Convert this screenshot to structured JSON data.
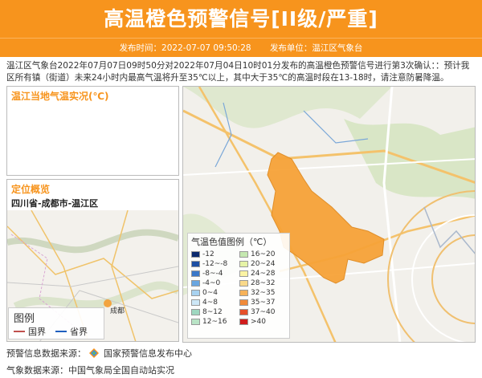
{
  "header": {
    "title": "高温橙色预警信号[II级/严重]",
    "publish_time_label": "发布时间：2022-07-07 09:50:28",
    "publisher_label": "发布单位：温江区气象台",
    "accent_color": "#f7941d"
  },
  "description": "温江区气象台2022年07月07日09时50分对2022年07月04日10时01分发布的高温橙色预警信号进行第3次确认：：预计我区所有镇（街道）未来24小时内最高气温将升至35℃以上，其中大于35℃的高温时段在13-18时，请注意防暑降温。",
  "temp_panel": {
    "title": "温江当地气温实况(℃)"
  },
  "location_panel": {
    "title": "定位概览",
    "subtitle": "四川省-成都市-温江区",
    "city_label": "成都"
  },
  "map_legend": {
    "title": "图例",
    "items": [
      {
        "label": "国界",
        "color": "#c0504d"
      },
      {
        "label": "省界",
        "color": "#1f5fbf"
      }
    ]
  },
  "temp_legend": {
    "title": "气温色值图例（℃）",
    "items": [
      {
        "label": "-12",
        "color": "#0b2a6f"
      },
      {
        "label": "16~20",
        "color": "#c5e8b0"
      },
      {
        "label": "-12~-8",
        "color": "#1d4fa3"
      },
      {
        "label": "20~24",
        "color": "#e6f3a6"
      },
      {
        "label": "-8~-4",
        "color": "#3a78c8"
      },
      {
        "label": "24~28",
        "color": "#fbf3a3"
      },
      {
        "label": "-4~0",
        "color": "#6aa6e0"
      },
      {
        "label": "28~32",
        "color": "#f9d98b"
      },
      {
        "label": "0~4",
        "color": "#a8d2f0"
      },
      {
        "label": "32~35",
        "color": "#f6b25a"
      },
      {
        "label": "4~8",
        "color": "#cde7f6"
      },
      {
        "label": "35~37",
        "color": "#f08a3a"
      },
      {
        "label": "8~12",
        "color": "#9fd7c0"
      },
      {
        "label": "37~40",
        "color": "#e5502b"
      },
      {
        "label": "12~16",
        "color": "#b9e4c6"
      },
      {
        "label": ">40",
        "color": "#d01c1c"
      }
    ]
  },
  "sources": {
    "warning_source": "预警信息数据来源：",
    "warning_source_name": "国家预警信息发布中心",
    "weather_source": "气象数据来源：中国气象局全国自动站实况"
  }
}
